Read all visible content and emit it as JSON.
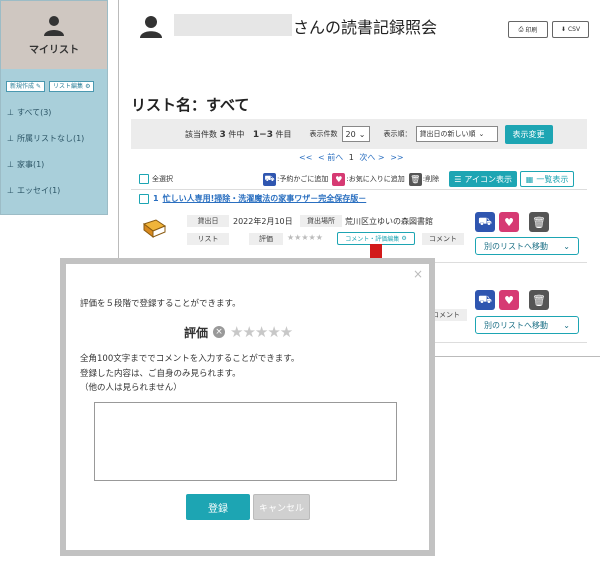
{
  "sidebar": {
    "title": "マイリスト",
    "new_button": "新規作成",
    "edit_button": "リスト編集",
    "items": [
      {
        "label": "すべて(3)"
      },
      {
        "label": "所属リストなし(1)"
      },
      {
        "label": "家事(1)"
      },
      {
        "label": "エッセイ(1)"
      }
    ]
  },
  "header": {
    "title": "さんの読書記録照会",
    "print_label": "印刷",
    "csv_label": "CSV"
  },
  "list": {
    "name_label": "リスト名：すべて"
  },
  "controls": {
    "hits_prefix": "該当件数",
    "hits_count": "3",
    "hits_mid": "件中",
    "range": "1−3",
    "range_suffix": "件目",
    "per_page_label": "表示件数",
    "per_page_value": "20",
    "order_label": "表示順：",
    "order_value": "貸出日の新しい順",
    "apply_button": "表示変更"
  },
  "pager": {
    "first": "<<",
    "prev": "< 前へ",
    "current": "1",
    "next": "次へ >",
    "last": ">>"
  },
  "toolbar": {
    "select_all": "全選択",
    "legend_reserve": ":予約かごに追加",
    "legend_fav": ":お気に入りに追加",
    "legend_delete": ":削除",
    "icon_view": "アイコン表示",
    "list_view": "一覧表示"
  },
  "book": {
    "number": "1",
    "title": "忙しい人専用!掃除・洗濯魔法の家事ワザ－完全保存版－",
    "lend_date_label": "貸出日",
    "lend_date": "2022年2月10日",
    "lend_place_label": "貸出場所",
    "lend_place": "荒川区立ゆいの森図書館",
    "list_label": "リスト",
    "rating_label": "評価",
    "rating_stars": "★★★★★",
    "comment_edit_button": "コメント・評価編集",
    "comment_label": "コメント",
    "move_button": "別のリストへ移動"
  },
  "book2": {
    "comment_label": "コメント",
    "move_button": "別のリストへ移動"
  },
  "modal": {
    "intro": "評価を５段階で登録することができます。",
    "rating_label": "評価",
    "clear_icon": "×",
    "stars": "★★★★★",
    "comment_intro": "全角100文字まででコメントを入力することができます。",
    "comment_note1": "登録した内容は、ご自身のみ見られます。",
    "comment_note2": "（他の人は見られません）",
    "comment_value": "",
    "submit_button": "登録",
    "cancel_button": "キャンセル",
    "close_icon": "×"
  },
  "colors": {
    "teal": "#1da5b3",
    "blue_icon": "#2f56b0",
    "pink_icon": "#d63a73",
    "gray_icon": "#555555",
    "arrow_red": "#d21919"
  }
}
